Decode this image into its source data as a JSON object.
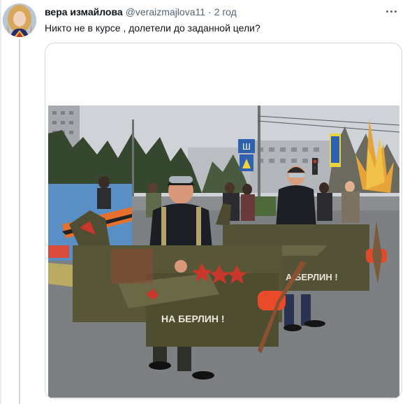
{
  "tweet": {
    "author_name": "вера измайлова",
    "handle": "@veraizmajlova11",
    "separator": "·",
    "time": "2 год",
    "text": "Никто не в курсе , долетели до заданной цели?",
    "more_icon": "more-horizontal-icon"
  },
  "photo": {
    "plane_slogan": "НА БЕРЛИН !",
    "plane_slogan_rear": "А БЕРЛИН !",
    "sign_text": "Ш"
  }
}
